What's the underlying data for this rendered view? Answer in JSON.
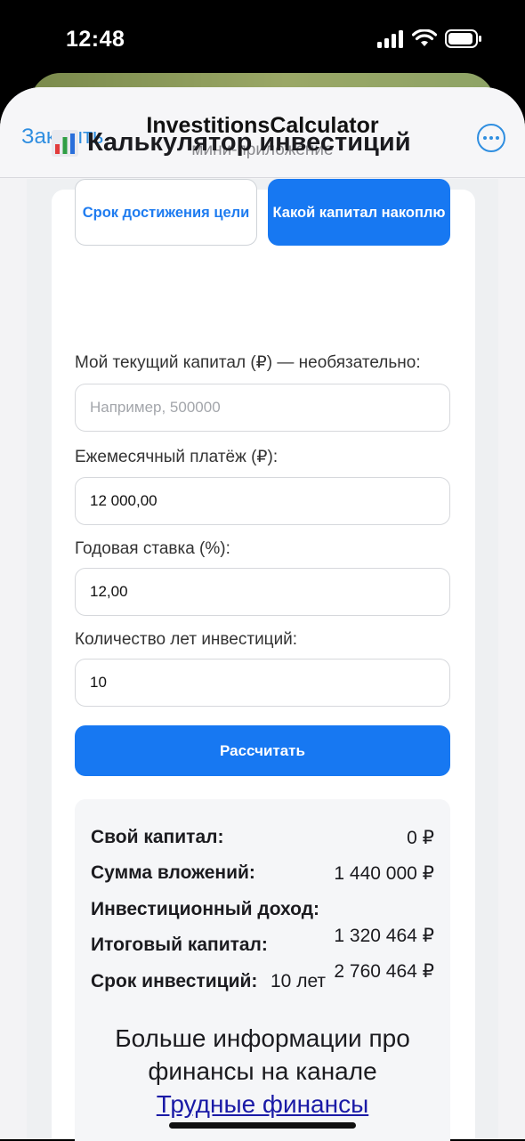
{
  "status_bar": {
    "time": "12:48"
  },
  "header": {
    "close_label": "Закрыть",
    "title": "InvestitionsCalculator",
    "subtitle": "мини-приложение"
  },
  "calculator": {
    "title": "Калькулятор инвестиций",
    "title_icon": "bar-chart-icon",
    "modes": [
      {
        "label": "Срок достижения цели",
        "selected": false
      },
      {
        "label": "Какой капитал накоплю",
        "selected": true
      }
    ],
    "fields": {
      "current_capital": {
        "label": "Мой текущий капитал (₽) — необязательно:",
        "placeholder": "Например, 500000",
        "value": ""
      },
      "monthly_payment": {
        "label": "Ежемесячный платёж (₽):",
        "value": "12 000,00"
      },
      "annual_rate": {
        "label": "Годовая ставка (%):",
        "value": "12,00"
      },
      "years": {
        "label": "Количество лет инвестиций:",
        "value": "10"
      }
    },
    "calculate_label": "Рассчитать"
  },
  "results": {
    "own_capital": {
      "label": "Свой капитал:",
      "value": "0 ₽"
    },
    "total_contributions": {
      "label": "Сумма вложений:",
      "value": "1 440 000 ₽"
    },
    "investment_income": {
      "label": "Инвестиционный доход:",
      "value": "1 320 464 ₽"
    },
    "final_capital": {
      "label": "Итоговый капитал:",
      "value": "2 760 464 ₽"
    },
    "term": {
      "label": "Срок инвестиций:",
      "value": "10 лет"
    }
  },
  "promo": {
    "text_line1": "Больше информации про",
    "text_line2": "финансы на канале",
    "link_text": "Трудные финансы"
  },
  "colors": {
    "accent": "#1778f2",
    "link": "#2f8ee0"
  }
}
